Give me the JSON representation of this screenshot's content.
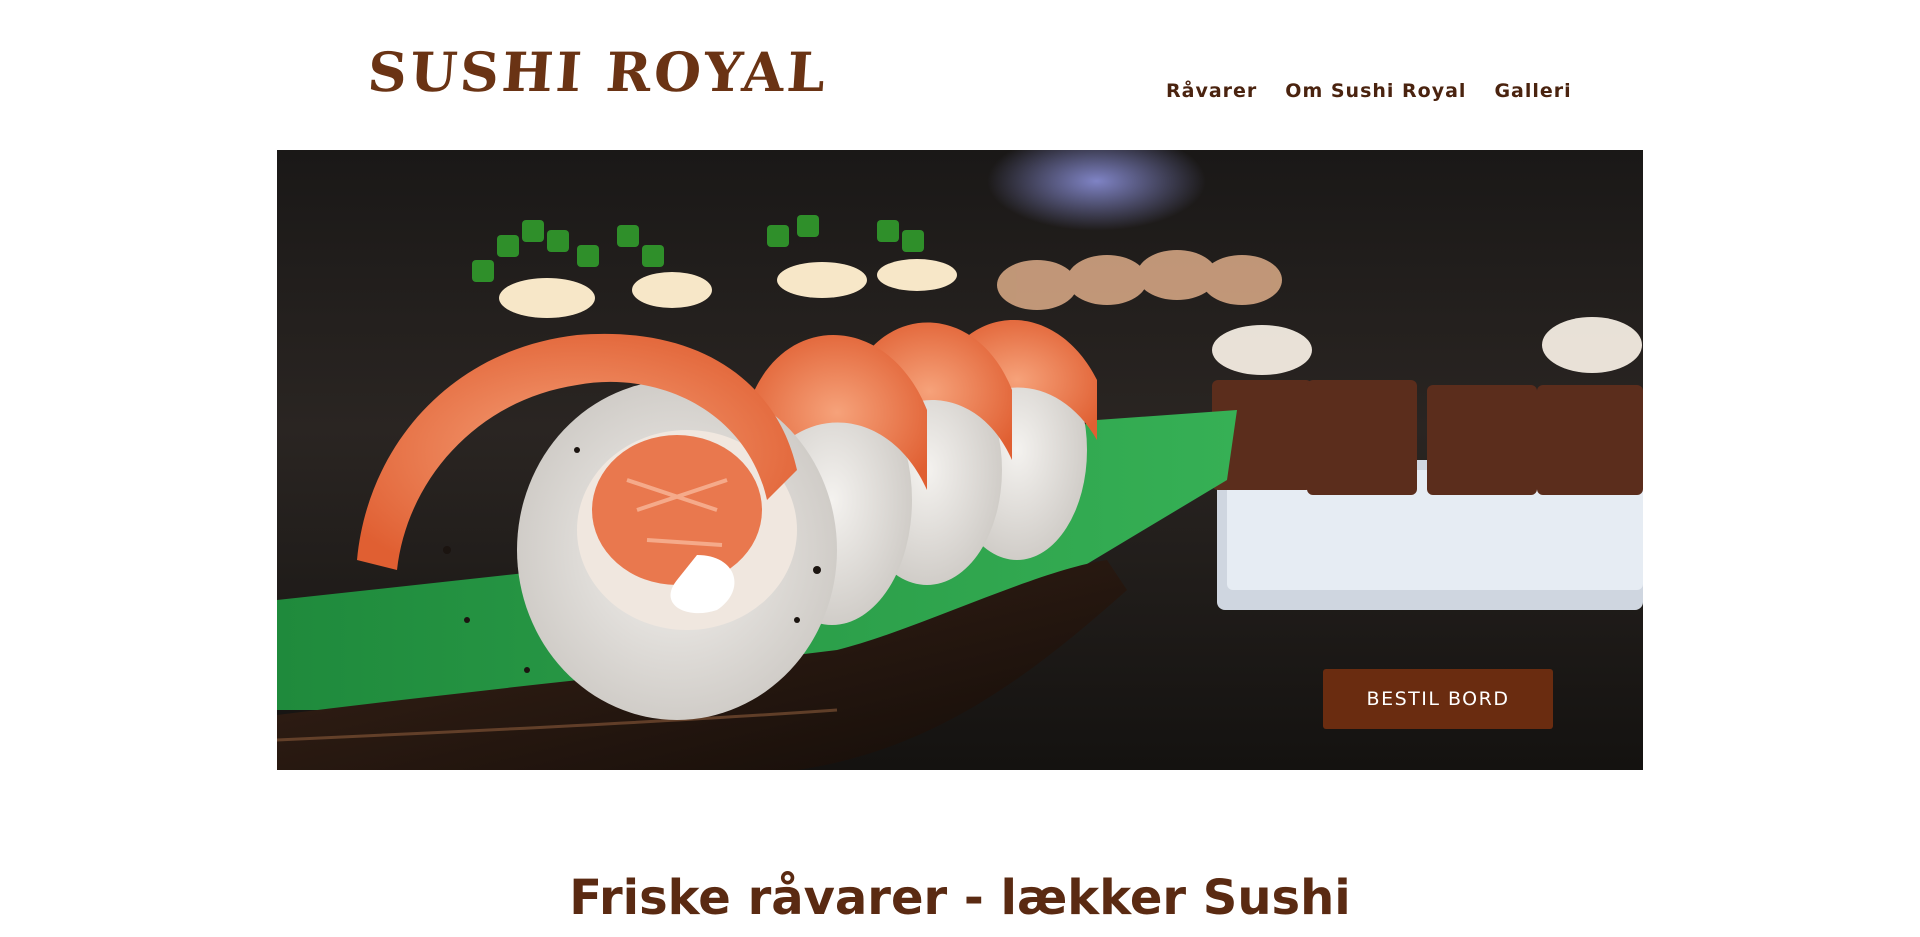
{
  "header": {
    "logo_text": "SUSHI ROYAL",
    "nav": [
      {
        "label": "Råvarer"
      },
      {
        "label": "Om Sushi Royal"
      },
      {
        "label": "Galleri"
      }
    ]
  },
  "hero": {
    "cta_label": "BESTIL BORD"
  },
  "main": {
    "tagline": "Friske råvarer - lækker Sushi"
  },
  "colors": {
    "brand_brown": "#6a2c10",
    "text_brown": "#5a2a12",
    "background": "#ffffff"
  }
}
